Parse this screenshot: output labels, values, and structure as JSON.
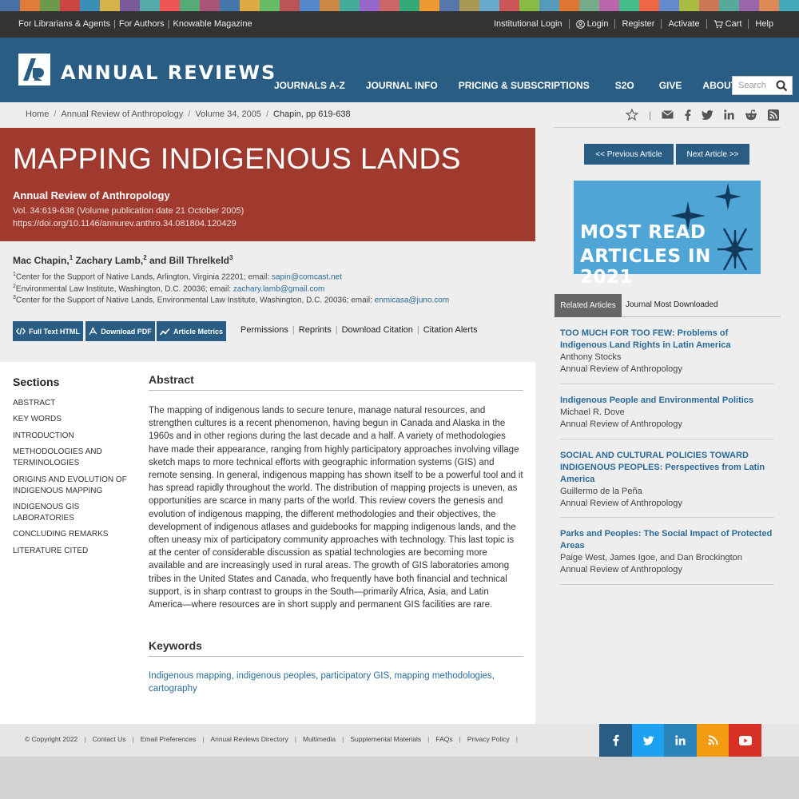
{
  "stripe_colors": [
    "#4a6fa5",
    "#e07b39",
    "#6a9a4a",
    "#c44",
    "#3a8fb7",
    "#d4b44a",
    "#7a5a9a",
    "#5aa",
    "#e55",
    "#5a7",
    "#a57",
    "#47a",
    "#da4",
    "#6b6",
    "#b55",
    "#58c",
    "#c84",
    "#4a9",
    "#96c",
    "#c66",
    "#3a7",
    "#e93",
    "#57a",
    "#a95",
    "#6ac",
    "#c55",
    "#8b4",
    "#59b",
    "#d73",
    "#7a8",
    "#b6a",
    "#4b8",
    "#e64",
    "#68c",
    "#ab4",
    "#c75",
    "#5a9",
    "#96a",
    "#d85",
    "#4ab"
  ],
  "util": {
    "left_links": [
      "For Librarians & Agents",
      "For Authors",
      "Knowable Magazine"
    ],
    "right": {
      "institutional_login": "Institutional Login",
      "login": "Login",
      "register": "Register",
      "activate": "Activate",
      "cart": "Cart",
      "help": "Help"
    }
  },
  "header": {
    "brand": "ANNUAL REVIEWS",
    "nav": [
      "JOURNALS A-Z",
      "JOURNAL INFO",
      "PRICING & SUBSCRIPTIONS",
      "S2O",
      "GIVE",
      "ABOUT"
    ],
    "search_placeholder": "Search"
  },
  "breadcrumb": {
    "home": "Home",
    "journal": "Annual Review of Anthropology",
    "volume": "Volume 34, 2005",
    "current": "Chapin, pp 619-638"
  },
  "article": {
    "title": "MAPPING INDIGENOUS LANDS",
    "journal": "Annual Review of Anthropology",
    "volume_line": "Vol. 34:619-638 (Volume publication date 21 October 2005)",
    "doi": "https://doi.org/10.1146/annurev.anthro.34.081804.120429",
    "authors": [
      {
        "name": "Mac Chapin,",
        "sup": "1"
      },
      {
        "name": "Zachary Lamb,",
        "sup": "2"
      },
      {
        "name": "and Bill Threlkeld",
        "sup": "3"
      }
    ],
    "affiliations": [
      {
        "sup": "1",
        "text": "Center for the Support of Native Lands, Arlington, Virginia 22201; email: ",
        "email": "sapin@comcast.net"
      },
      {
        "sup": "2",
        "text": "Environmental Law Institute, Washington, D.C. 20036; email: ",
        "email": "zachary.lamb@gmail.com"
      },
      {
        "sup": "3",
        "text": "Center for the Support of Native Lands, Environmental Law Institute, Washington, D.C. 20036; email: ",
        "email": "enmicasa@juno.com"
      }
    ],
    "buttons": {
      "full_text": "Full Text HTML",
      "pdf": "Download PDF",
      "metrics": "Article Metrics"
    },
    "links": [
      "Permissions",
      "Reprints",
      "Download Citation",
      "Citation Alerts"
    ]
  },
  "sections": {
    "heading": "Sections",
    "items": [
      "ABSTRACT",
      "KEY WORDS",
      "INTRODUCTION",
      "METHODOLOGIES AND TERMINOLOGIES",
      "ORIGINS AND EVOLUTION OF INDIGENOUS MAPPING",
      "INDIGENOUS GIS LABORATORIES",
      "CONCLUDING REMARKS",
      "LITERATURE CITED"
    ]
  },
  "abstract": {
    "heading": "Abstract",
    "text": "The mapping of indigenous lands to secure tenure, manage natural resources, and strengthen cultures is a recent phenomenon, having begun in Canada and Alaska in the 1960s and in other regions during the last decade and a half. A variety of methodologies have made their appearance, ranging from highly participatory approaches involving village sketch maps to more technical efforts with geographic information systems (GIS) and remote sensing. In general, indigenous mapping has shown itself to be a powerful tool and it has spread rapidly throughout the world. The distribution of mapping projects is uneven, as opportunities are scarce in many parts of the world. This review covers the genesis and evolution of indigenous mapping, the different methodologies and their objectives, the development of indigenous atlases and guidebooks for mapping indigenous lands, and the often uneasy mix of participatory community approaches with technology. This last topic is at the center of considerable discussion as spatial technologies are becoming more available and are increasingly used in rural areas. The growth of GIS laboratories among tribes in the United States and Canada, who frequently have both financial and technical support, is in sharp contrast to groups in the South—primarily Africa, Asia, and Latin America—where resources are in short supply and permanent GIS facilities are rare."
  },
  "keywords": {
    "heading": "Keywords",
    "items": [
      "Indigenous mapping",
      "indigenous peoples",
      "participatory GIS",
      "mapping methodologies",
      "cartography"
    ]
  },
  "sidebar": {
    "prev": "<< Previous Article",
    "next": "Next Article >>",
    "banner_line1": "MOST READ",
    "banner_line2": "ARTICLES IN 2021",
    "tab_related": "Related Articles",
    "tab_most": "Journal Most Downloaded",
    "related": [
      {
        "title": "TOO MUCH FOR TOO FEW: Problems of Indigenous Land Rights in Latin America",
        "authors": "Anthony Stocks",
        "journal": "Annual Review of Anthropology"
      },
      {
        "title": "Indigenous People and Environmental Politics",
        "authors": "Michael R. Dove",
        "journal": "Annual Review of Anthropology"
      },
      {
        "title": "SOCIAL AND CULTURAL POLICIES TOWARD INDIGENOUS PEOPLES: Perspectives from Latin America",
        "authors": "Guillermo de la Peña",
        "journal": "Annual Review of Anthropology"
      },
      {
        "title": "Parks and Peoples: The Social Impact of Protected Areas",
        "authors": "Paige West, James Igoe, and Dan Brockington",
        "journal": "Annual Review of Anthropology"
      }
    ]
  },
  "footer": {
    "links": [
      "© Copyright 2022",
      "Contact Us",
      "Email Preferences",
      "Annual Reviews Directory",
      "Multimedia",
      "Supplemental Materials",
      "FAQs",
      "Privacy Policy"
    ],
    "social": [
      {
        "icon": "facebook-icon",
        "color": "#2a5d84"
      },
      {
        "icon": "twitter-icon",
        "color": "#1da1f2"
      },
      {
        "icon": "linkedin-icon",
        "color": "#2a84b8"
      },
      {
        "icon": "rss-icon",
        "color": "#f39c12"
      },
      {
        "icon": "youtube-icon",
        "color": "#d93025"
      }
    ]
  }
}
